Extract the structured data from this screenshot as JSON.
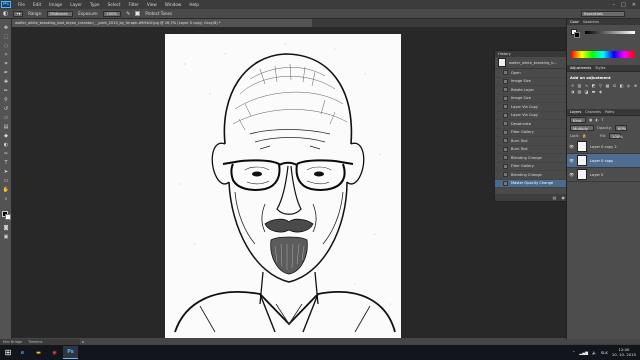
{
  "menubar": {
    "items": [
      "File",
      "Edit",
      "Image",
      "Layer",
      "Type",
      "Select",
      "Filter",
      "View",
      "Window",
      "Help"
    ],
    "logo": "Ps"
  },
  "options": {
    "range_label": "Range:",
    "range_value": "Midtones",
    "exposure_label": "Exposure:",
    "exposure_value": "100%",
    "protect_label": "Protect Tones",
    "workspace": "Essentials"
  },
  "document": {
    "tab_title": "walter_white_breaking_bad_bryan_cranston_ _print_2015_by_feraph-d9i9b1f.jpg @ 26,7% (Layer 0 copy, Gray/8) *"
  },
  "status": {
    "zoom": "26,77%",
    "doc_size": "Doc: 7,42M/9,23M"
  },
  "mini_bridge": {
    "tab_bridge": "Mini Bridge",
    "tab_timeline": "Timeline"
  },
  "history": {
    "title": "History",
    "snapshot": "walter_white_breaking_b...",
    "items": [
      "Open",
      "Image Size",
      "Rotate Layer",
      "Image Size",
      "Layer Via Copy",
      "Layer Via Copy",
      "Desaturate",
      "Filter Gallery",
      "Burn Tool",
      "Burn Tool",
      "Blending Change",
      "Filter Gallery",
      "Blending Change",
      "Master Opacity Change"
    ],
    "active_index": 13
  },
  "right_panels": {
    "color_tabs": [
      "Color",
      "Swatches"
    ],
    "adjust_tabs": [
      "Adjustments",
      "Styles"
    ],
    "adjust_title": "Add an adjustment",
    "layers_tabs": [
      "Layers",
      "Channels",
      "Paths"
    ],
    "blend_mode": "Multiply",
    "opacity_label": "Opacity:",
    "opacity_value": "60%",
    "fill_label": "Fill:",
    "fill_value": "100%",
    "layers": [
      {
        "name": "Layer 0 copy 2",
        "visible": true,
        "selected": false
      },
      {
        "name": "Layer 0 copy",
        "visible": true,
        "selected": true
      },
      {
        "name": "Layer 0",
        "visible": true,
        "selected": false
      }
    ]
  },
  "taskbar": {
    "lang": "SLK",
    "time": "12:40",
    "date": "10. 10. 2015",
    "apps": [
      "IE",
      "Folder",
      "Chrome",
      "Ps"
    ]
  },
  "colors": {
    "accent": "#4f6d91",
    "history_active": "#4a6a8e"
  }
}
